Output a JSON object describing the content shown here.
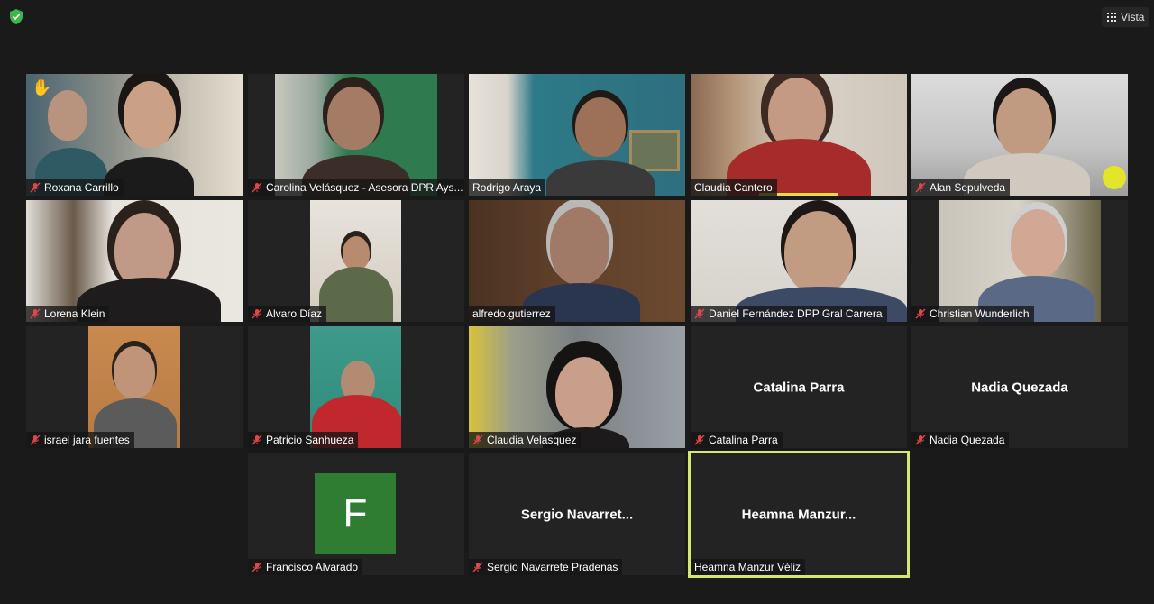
{
  "header": {
    "view_label": "Vista",
    "security_icon": "shield-check-icon",
    "accent": "#3cb54a"
  },
  "participants": [
    {
      "name": "Roxana Carrillo",
      "muted": true,
      "video": true,
      "hand_raised": true
    },
    {
      "name": "Carolina Velásquez - Asesora DPR Ays...",
      "muted": true,
      "video": true
    },
    {
      "name": "Rodrigo Araya",
      "muted": false,
      "video": true
    },
    {
      "name": "Claudia Cantero",
      "muted": false,
      "video": true,
      "speaking": true
    },
    {
      "name": "Alan Sepulveda",
      "muted": true,
      "video": true
    },
    {
      "name": "Lorena Klein",
      "muted": true,
      "video": true
    },
    {
      "name": "Alvaro Díaz",
      "muted": true,
      "video": true
    },
    {
      "name": "alfredo.gutierrez",
      "muted": false,
      "video": true
    },
    {
      "name": "Daniel Fernández DPP Gral Carrera",
      "muted": true,
      "video": true
    },
    {
      "name": "Christian Wunderlich",
      "muted": true,
      "video": true
    },
    {
      "name": "israel jara fuentes",
      "muted": true,
      "video": true
    },
    {
      "name": "Patricio Sanhueza",
      "muted": true,
      "video": true
    },
    {
      "name": "Claudia Velasquez",
      "muted": true,
      "video": true
    },
    {
      "name": "Catalina Parra",
      "display": "Catalina Parra",
      "muted": true,
      "video": false
    },
    {
      "name": "Nadia Quezada",
      "display": "Nadia Quezada",
      "muted": true,
      "video": false
    },
    {
      "name": "Francisco Alvarado",
      "avatar_letter": "F",
      "muted": true,
      "video": false
    },
    {
      "name": "Sergio Navarrete Pradenas",
      "display": "Sergio  Navarret...",
      "muted": true,
      "video": false
    },
    {
      "name": "Heamna Manzur Véliz",
      "display": "Heamna  Manzur...",
      "muted": false,
      "video": false,
      "active": true
    }
  ],
  "colors": {
    "muted_icon": "#e0464a",
    "active_border": "#d4e87a",
    "avatar_bg": "#2e7d32"
  }
}
